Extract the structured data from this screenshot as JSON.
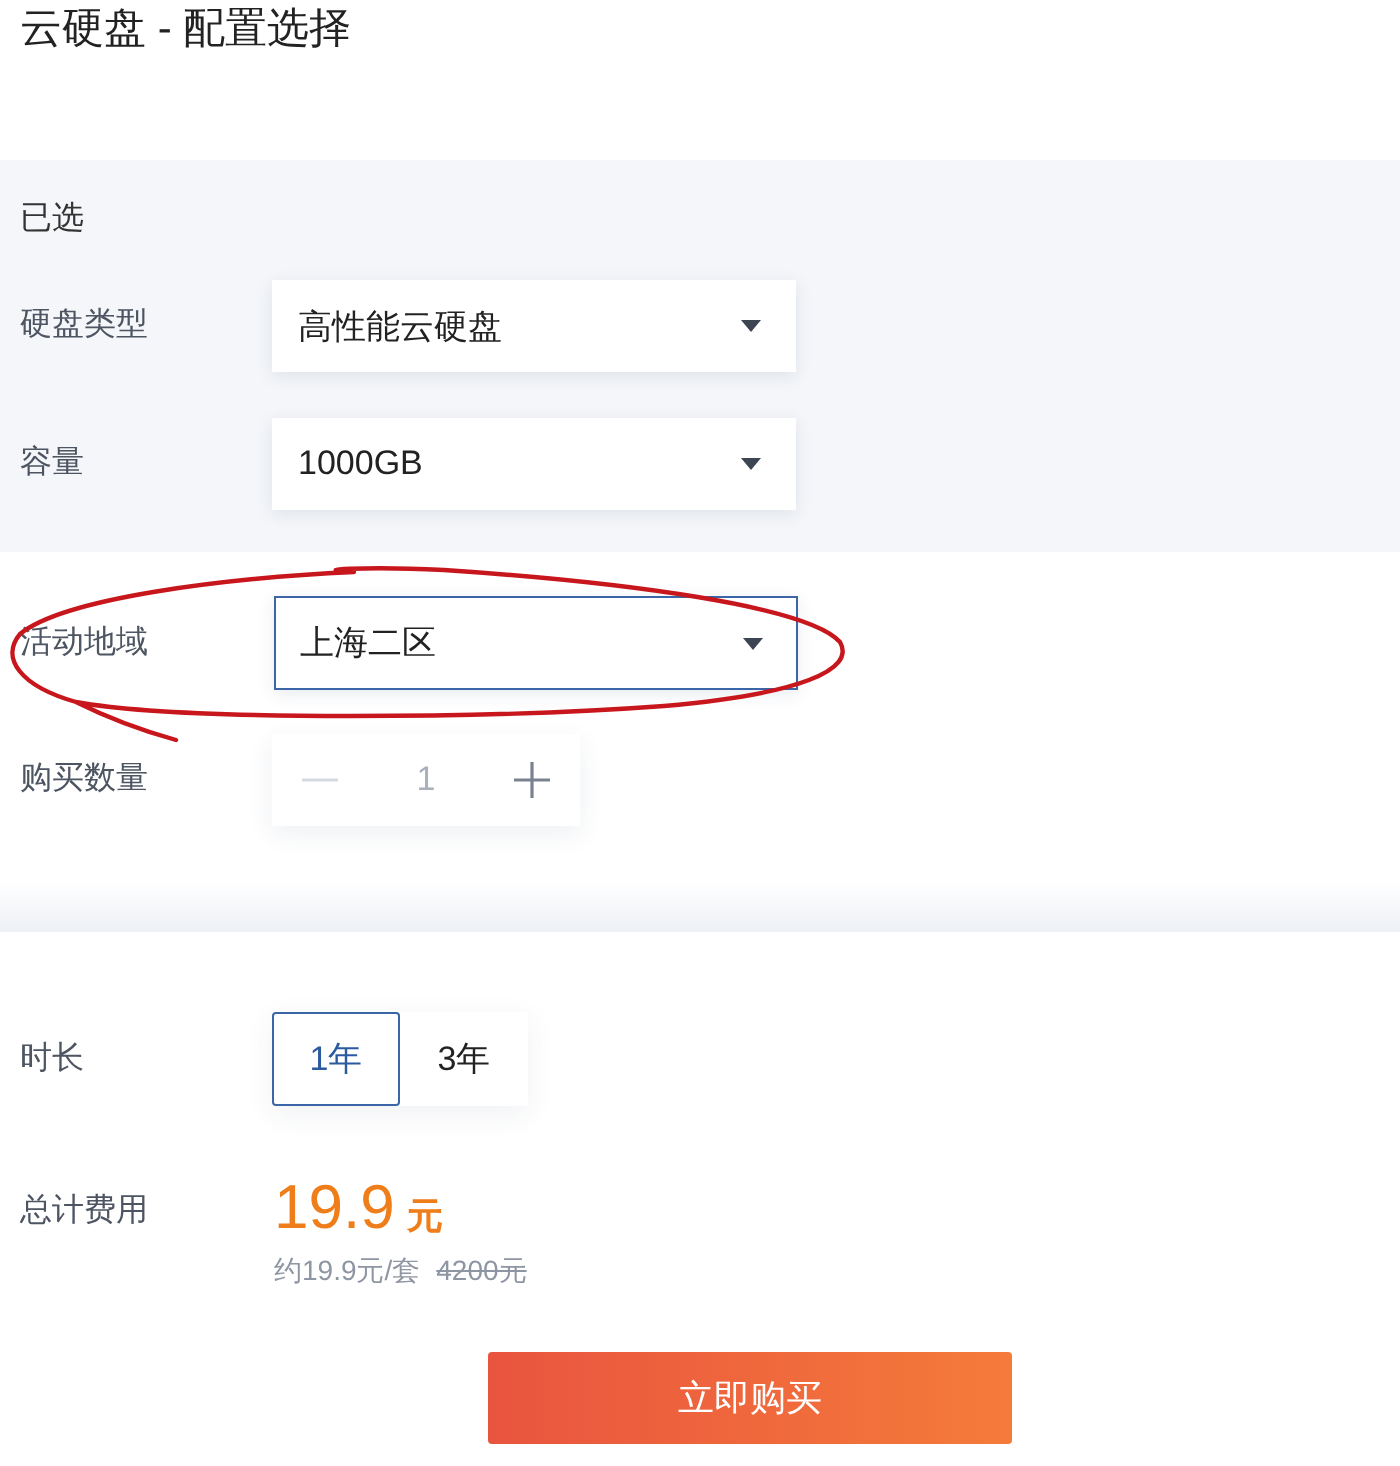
{
  "page": {
    "title": "云硬盘 - 配置选择"
  },
  "selected_section": {
    "heading": "已选",
    "fields": [
      {
        "label": "硬盘类型",
        "value": "高性能云硬盘",
        "focused": false
      },
      {
        "label": "容量",
        "value": "1000GB",
        "focused": false
      }
    ]
  },
  "region_field": {
    "label": "活动地域",
    "value": "上海二区",
    "focused": true,
    "circled": true
  },
  "quantity": {
    "label": "购买数量",
    "value": "1",
    "decrement_disabled": true,
    "increment_disabled": false
  },
  "duration": {
    "label": "时长",
    "options": [
      {
        "label": "1年",
        "selected": true
      },
      {
        "label": "3年",
        "selected": false
      }
    ]
  },
  "total": {
    "label": "总计费用",
    "price": "19.9",
    "currency": "元",
    "unit_price": "约19.9元/套",
    "original_price": "4200元"
  },
  "buy_button": {
    "label": "立即购买"
  }
}
